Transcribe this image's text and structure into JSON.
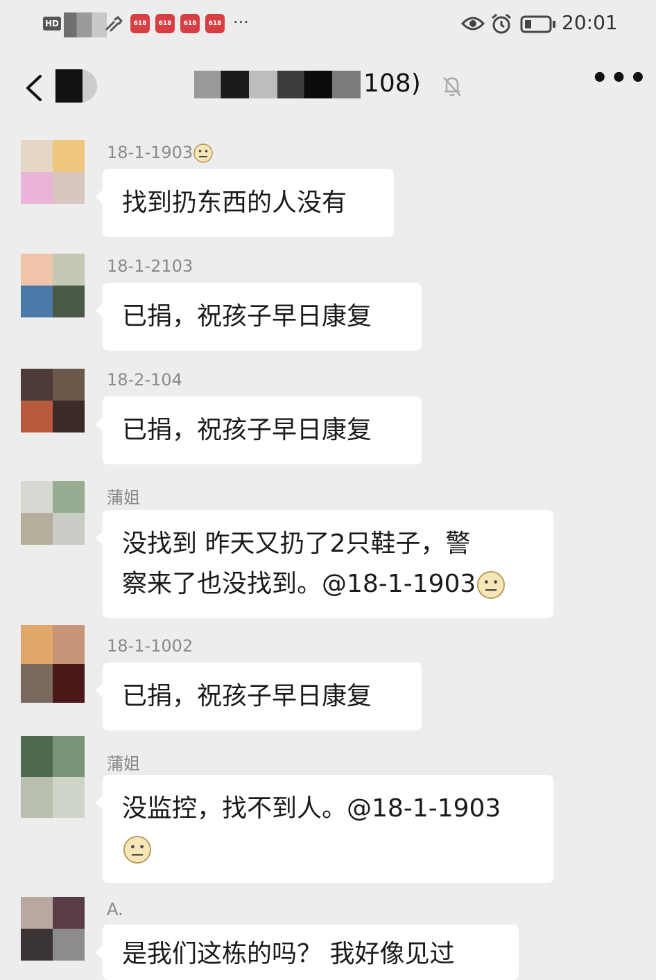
{
  "status_bar": {
    "hd_label": "HD",
    "app_icon_label": "618",
    "more_notifications": "···",
    "clock": "20:01"
  },
  "nav": {
    "title_visible": "108)"
  },
  "messages": [
    {
      "sender": "18-1-1903",
      "sender_emoji": "neutral-face-emoji",
      "text": "找到扔东西的人没有"
    },
    {
      "sender": "18-1-2103",
      "text": "已捐，祝孩子早日康复"
    },
    {
      "sender": "18-2-104",
      "text": "已捐，祝孩子早日康复"
    },
    {
      "sender": "蒲姐",
      "text_line1": "没找到 昨天又扔了2只鞋子，警",
      "text_line2": "察来了也没找到。@18-1-1903",
      "trailing_emoji": "neutral-face-emoji"
    },
    {
      "sender": "18-1-1002",
      "text": "已捐，祝孩子早日康复"
    },
    {
      "sender": "蒲姐",
      "text": "没监控，找不到人。@18-1-1903",
      "trailing_emoji": "neutral-face-emoji"
    },
    {
      "sender": "A.",
      "text": "是我们这栋的吗？ 我好像见过"
    }
  ],
  "colors": {
    "background": "#ededed",
    "bubble": "#ffffff",
    "sender_name": "#8a8a8a",
    "app_icon": "#d64045"
  }
}
